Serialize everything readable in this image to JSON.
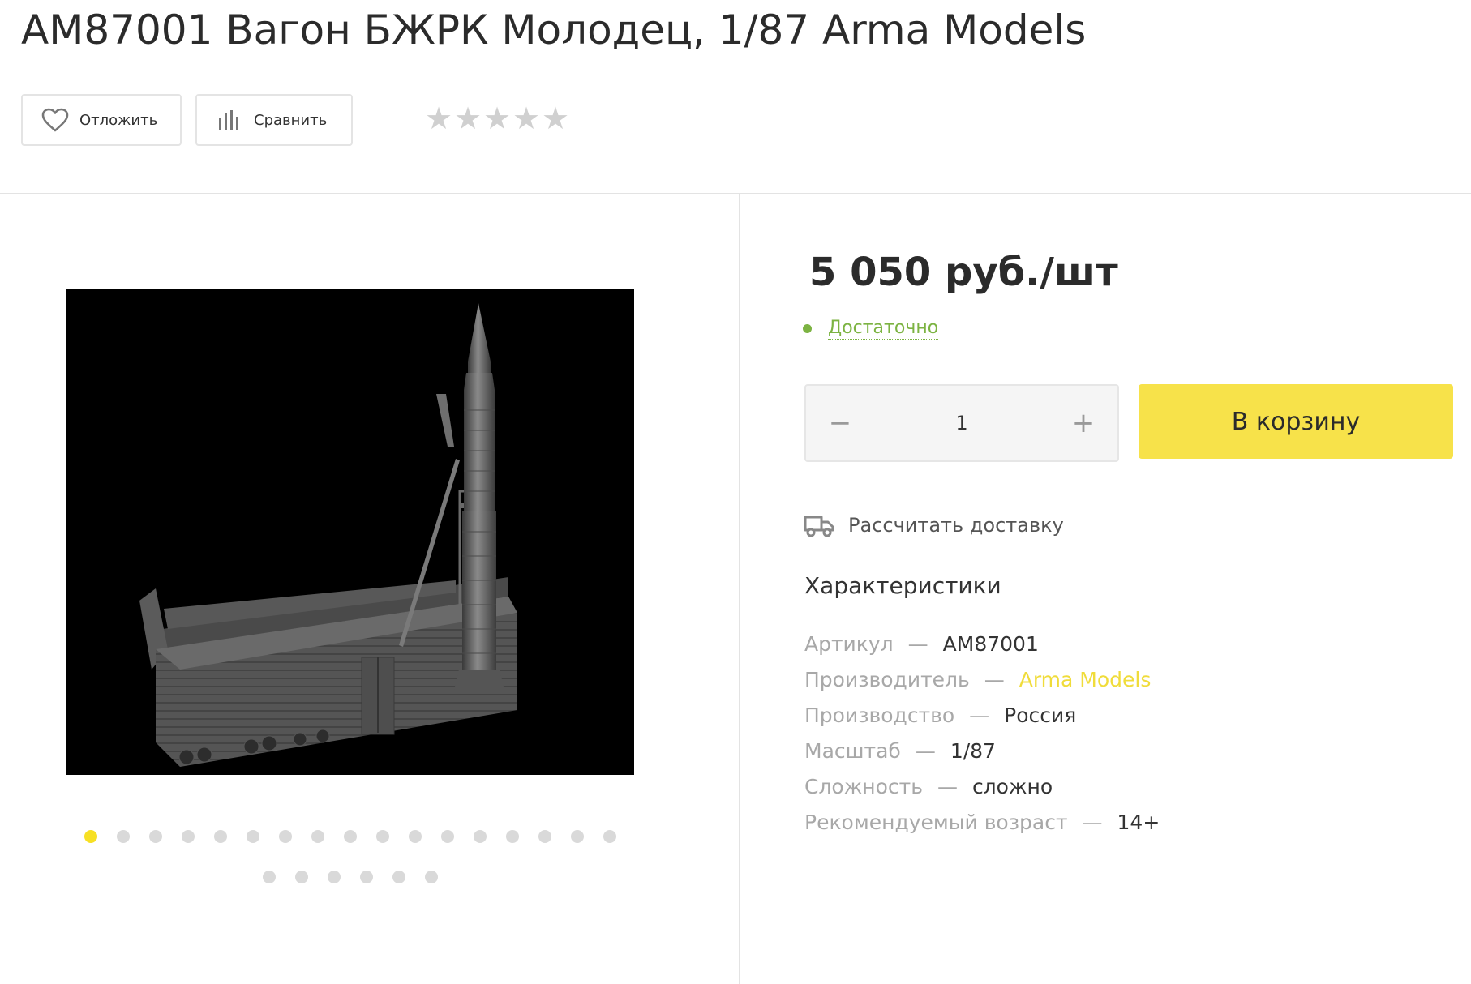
{
  "product": {
    "title": "AM87001 Вагон БЖРК Молодец, 1/87 Arma Models",
    "price": "5 050 руб./шт",
    "stock_status": "Достаточно",
    "rating": {
      "value": 0,
      "max": 5
    }
  },
  "actions": {
    "postpone_label": "Отложить",
    "compare_label": "Сравнить"
  },
  "purchase": {
    "quantity": "1",
    "minus_symbol": "−",
    "plus_symbol": "+",
    "cart_label": "В корзину",
    "delivery_label": "Рассчитать доставку"
  },
  "gallery": {
    "total_images": 23,
    "active_index": 0
  },
  "characteristics": {
    "title": "Характеристики",
    "rows": [
      {
        "key": "Артикул",
        "value": "AM87001",
        "link": false
      },
      {
        "key": "Производитель",
        "value": "Arma Models",
        "link": true
      },
      {
        "key": "Производство",
        "value": "Россия",
        "link": false
      },
      {
        "key": "Масштаб",
        "value": "1/87",
        "link": false
      },
      {
        "key": "Сложность",
        "value": "сложно",
        "link": false
      },
      {
        "key": "Рекомендуемый возраст",
        "value": "14+",
        "link": false
      }
    ],
    "separator": "—"
  },
  "colors": {
    "accent_yellow": "#f7e24a",
    "stock_green": "#7cb342",
    "link_yellow": "#f0dc3a"
  },
  "icons": {
    "postpone": "heart-icon",
    "compare": "bar-chart-icon",
    "delivery": "truck-icon",
    "rating": "star-icon"
  }
}
